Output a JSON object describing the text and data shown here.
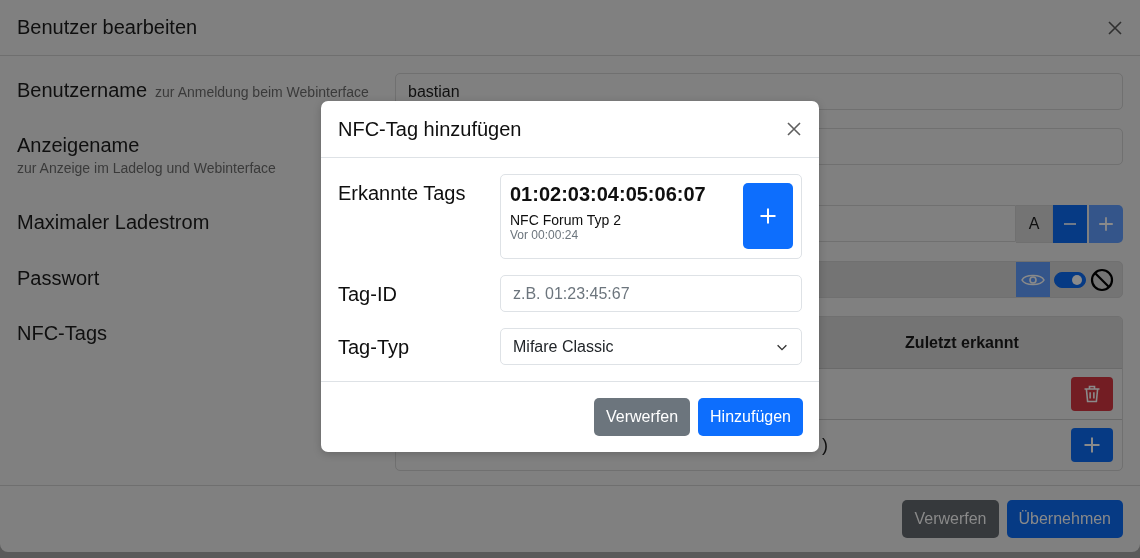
{
  "dialog": {
    "title": "Benutzer bearbeiten",
    "username": {
      "label": "Benutzername",
      "hint": "zur Anmeldung beim Webinterface",
      "value": "bastian"
    },
    "display_name": {
      "label": "Anzeigename",
      "hint": "zur Anzeige im Ladelog und Webinterface"
    },
    "max_current": {
      "label": "Maximaler Ladestrom",
      "unit": "A",
      "steppers": [
        {
          "kind": "minus",
          "disabled": false
        },
        {
          "kind": "plus",
          "disabled": true
        }
      ]
    },
    "password": {
      "label": "Passwort",
      "toggle_on": true
    },
    "nfc_tags": {
      "label": "NFC-Tags",
      "columns": [
        "Zuletzt erkannt"
      ],
      "rows": [
        {
          "kind": "delete"
        },
        {
          "kind": "add",
          "text": ")"
        }
      ]
    },
    "buttons": [
      {
        "label": "Verwerfen",
        "kind": "secondary"
      },
      {
        "label": "Übernehmen",
        "kind": "primary"
      }
    ]
  },
  "modal": {
    "title": "NFC-Tag hinzufügen",
    "detected": {
      "label": "Erkannte Tags",
      "tags": [
        {
          "id": "01:02:03:04:05:06:07",
          "type": "NFC Forum Typ 2",
          "age": "Vor 00:00:24"
        }
      ]
    },
    "tag_id": {
      "label": "Tag-ID",
      "placeholder": "z.B. 01:23:45:67"
    },
    "tag_type": {
      "label": "Tag-Typ",
      "value": "Mifare Classic"
    },
    "buttons": [
      {
        "label": "Verwerfen",
        "kind": "secondary"
      },
      {
        "label": "Hinzufügen",
        "kind": "primary"
      }
    ]
  }
}
